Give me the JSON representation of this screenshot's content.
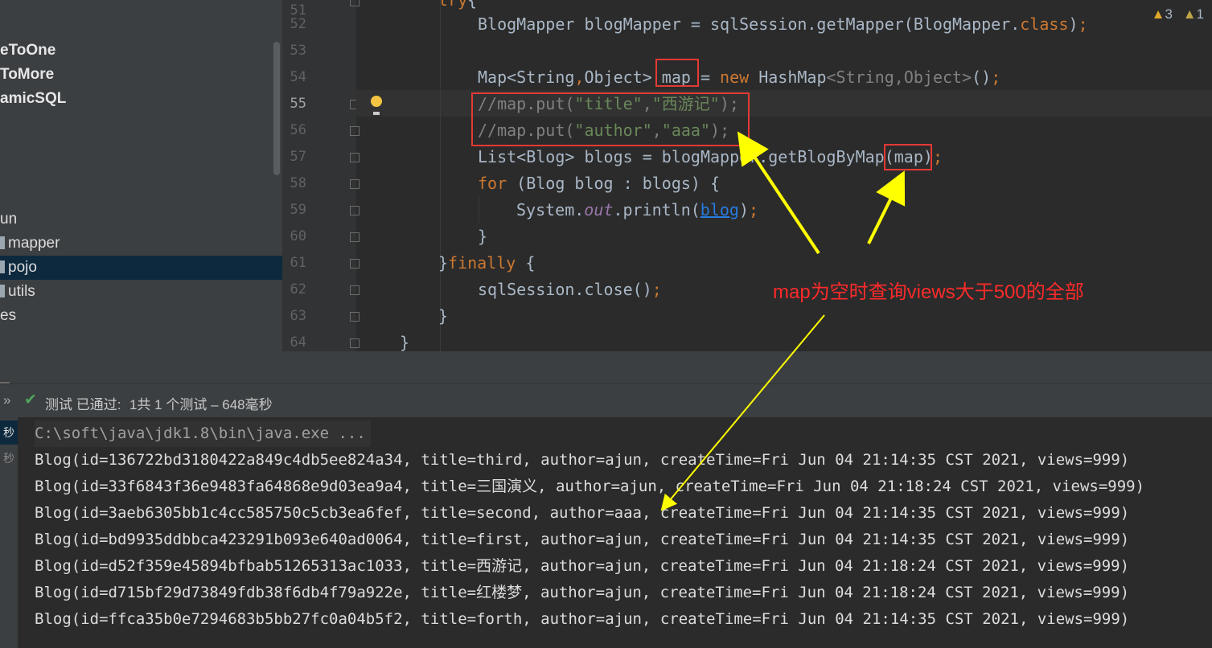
{
  "sidebar": {
    "items": [
      {
        "label": "eToOne",
        "bold": true
      },
      {
        "label": "ToMore",
        "bold": true
      },
      {
        "label": "amicSQL",
        "bold": true
      },
      {
        "label": "un",
        "bold": false
      },
      {
        "label": "mapper",
        "bold": false
      },
      {
        "label": "pojo",
        "bold": false,
        "selected": true
      },
      {
        "label": "utils",
        "bold": false
      },
      {
        "label": "es",
        "bold": false
      }
    ]
  },
  "editor": {
    "line_numbers": [
      "51",
      "52",
      "53",
      "54",
      "55",
      "56",
      "57",
      "58",
      "59",
      "60",
      "61",
      "62",
      "63",
      "64"
    ],
    "current_line": "55",
    "warnings": {
      "warn_count": "3",
      "weak_warn_count": "1"
    }
  },
  "run_panel": {
    "status_prefix": "测试 已通过: ",
    "status_detail": "1共 1 个测试 – 648毫秒",
    "left_labels": [
      "秒",
      "秒"
    ]
  },
  "console": {
    "command": "C:\\soft\\java\\jdk1.8\\bin\\java.exe ...",
    "lines": [
      "Blog(id=136722bd3180422a849c4db5ee824a34, title=third, author=ajun, createTime=Fri Jun 04 21:14:35 CST 2021, views=999)",
      "Blog(id=33f6843f36e9483fa64868e9d03ea9a4, title=三国演义, author=ajun, createTime=Fri Jun 04 21:18:24 CST 2021, views=999)",
      "Blog(id=3aeb6305bb1c4cc585750c5cb3ea6fef, title=second, author=aaa, createTime=Fri Jun 04 21:14:35 CST 2021, views=999)",
      "Blog(id=bd9935ddbbca423291b093e640ad0064, title=first, author=ajun, createTime=Fri Jun 04 21:14:35 CST 2021, views=999)",
      "Blog(id=d52f359e45894bfbab51265313ac1033, title=西游记, author=ajun, createTime=Fri Jun 04 21:18:24 CST 2021, views=999)",
      "Blog(id=d715bf29d73849fdb38f6db4f79a922e, title=红楼梦, author=ajun, createTime=Fri Jun 04 21:18:24 CST 2021, views=999)",
      "Blog(id=ffca35b0e7294683b5bb27fc0a04b5f2, title=forth, author=ajun, createTime=Fri Jun 04 21:14:35 CST 2021, views=999)"
    ]
  },
  "annotation": {
    "text": "map为空时查询views大于500的全部",
    "color": "#ff2a2a"
  },
  "colors": {
    "keyword": "#cc7832",
    "string": "#6a8759",
    "comment": "#808080",
    "annotation_box": "#e53935",
    "arrow": "#ffff00"
  }
}
